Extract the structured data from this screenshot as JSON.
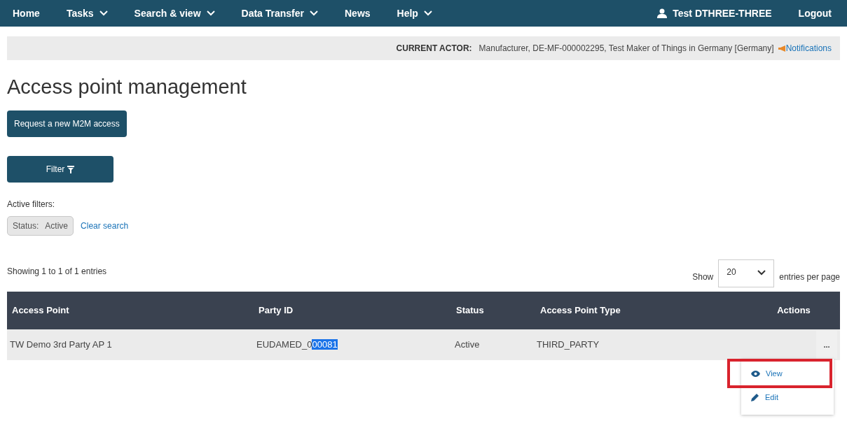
{
  "nav": {
    "items": [
      {
        "label": "Home",
        "dropdown": false
      },
      {
        "label": "Tasks",
        "dropdown": true
      },
      {
        "label": "Search & view",
        "dropdown": true
      },
      {
        "label": "Data Transfer",
        "dropdown": true
      },
      {
        "label": "News",
        "dropdown": false
      },
      {
        "label": "Help",
        "dropdown": true
      }
    ],
    "user": "Test DTHREE-THREE",
    "logout": "Logout"
  },
  "actor_bar": {
    "label": "CURRENT ACTOR:",
    "value": "Manufacturer, DE-MF-000002295, Test Maker of Things in Germany [Germany]",
    "notifications": "Notifications"
  },
  "title": "Access point management",
  "request_button": "Request a new M2M access",
  "filter_button": "Filter",
  "active_filters": {
    "label": "Active filters:",
    "chips": [
      {
        "key": "Status:",
        "value": "Active"
      }
    ],
    "clear": "Clear search"
  },
  "summary": "Showing 1 to 1 of 1 entries",
  "page_size": {
    "label": "Show",
    "value": "20",
    "suffix": "entries per page"
  },
  "table": {
    "columns": [
      "Access Point",
      "Party ID",
      "Status",
      "Access Point Type",
      "Actions"
    ],
    "rows": [
      {
        "access_point": "TW Demo 3rd Party AP 1",
        "party_id": "EUDAMED_0",
        "party_id_selected_part": "00081",
        "status": "Active",
        "type": "THIRD_PARTY",
        "actions": "..."
      }
    ]
  },
  "action_menu": [
    {
      "kind": "view",
      "label": "View",
      "selected": true
    },
    {
      "kind": "edit",
      "label": "Edit",
      "selected": false
    }
  ]
}
